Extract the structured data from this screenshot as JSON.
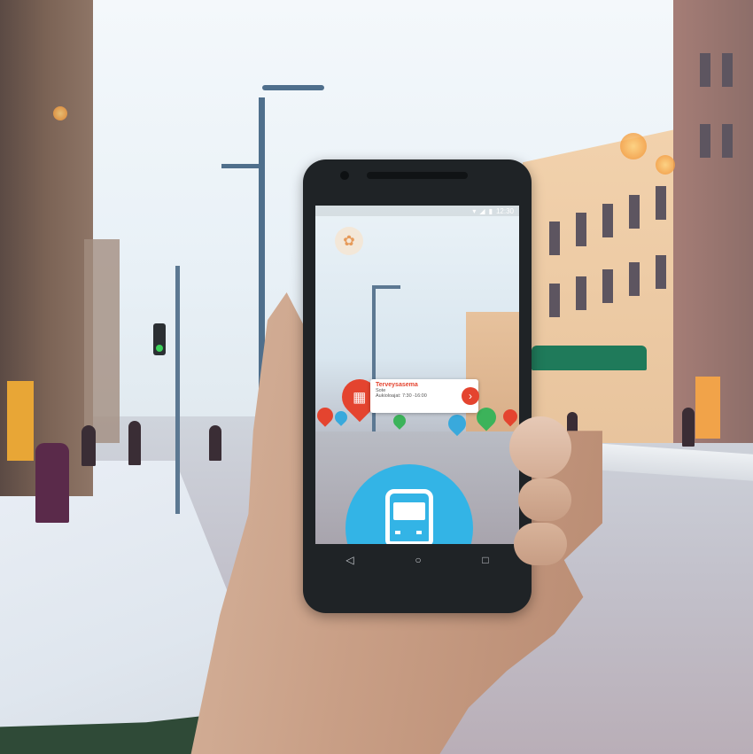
{
  "phone": {
    "status_time": "12:30",
    "poi_card": {
      "title": "Terveysasema",
      "subtitle": "Sote",
      "hours": "Aukioloajat: 7:30 -16:00"
    },
    "nav": {
      "back_icon": "◁",
      "home_icon": "○",
      "recents_icon": "□"
    },
    "icons": [
      "ar-logo-icon",
      "building-icon",
      "chevron-right-icon",
      "bus-icon",
      "bed-icon",
      "hotel-icon"
    ]
  },
  "colors": {
    "poi_red": "#e4442f",
    "bus_blue": "#33b4e6",
    "pin_green": "#3cb35a",
    "pin_blue": "#39a9dc"
  }
}
